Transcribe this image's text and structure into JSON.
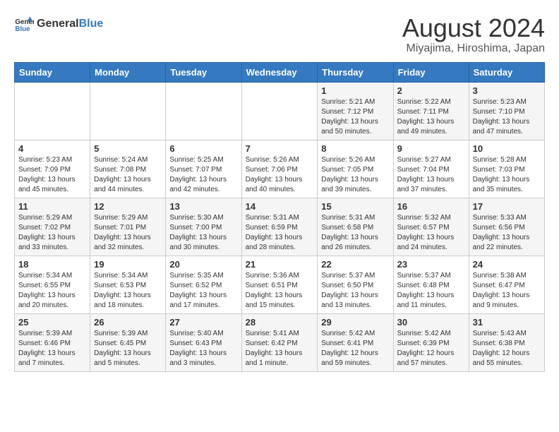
{
  "header": {
    "logo_general": "General",
    "logo_blue": "Blue",
    "title": "August 2024",
    "subtitle": "Miyajima, Hiroshima, Japan"
  },
  "calendar": {
    "days_of_week": [
      "Sunday",
      "Monday",
      "Tuesday",
      "Wednesday",
      "Thursday",
      "Friday",
      "Saturday"
    ],
    "weeks": [
      [
        {
          "day": "",
          "info": ""
        },
        {
          "day": "",
          "info": ""
        },
        {
          "day": "",
          "info": ""
        },
        {
          "day": "",
          "info": ""
        },
        {
          "day": "1",
          "info": "Sunrise: 5:21 AM\nSunset: 7:12 PM\nDaylight: 13 hours\nand 50 minutes."
        },
        {
          "day": "2",
          "info": "Sunrise: 5:22 AM\nSunset: 7:11 PM\nDaylight: 13 hours\nand 49 minutes."
        },
        {
          "day": "3",
          "info": "Sunrise: 5:23 AM\nSunset: 7:10 PM\nDaylight: 13 hours\nand 47 minutes."
        }
      ],
      [
        {
          "day": "4",
          "info": "Sunrise: 5:23 AM\nSunset: 7:09 PM\nDaylight: 13 hours\nand 45 minutes."
        },
        {
          "day": "5",
          "info": "Sunrise: 5:24 AM\nSunset: 7:08 PM\nDaylight: 13 hours\nand 44 minutes."
        },
        {
          "day": "6",
          "info": "Sunrise: 5:25 AM\nSunset: 7:07 PM\nDaylight: 13 hours\nand 42 minutes."
        },
        {
          "day": "7",
          "info": "Sunrise: 5:26 AM\nSunset: 7:06 PM\nDaylight: 13 hours\nand 40 minutes."
        },
        {
          "day": "8",
          "info": "Sunrise: 5:26 AM\nSunset: 7:05 PM\nDaylight: 13 hours\nand 39 minutes."
        },
        {
          "day": "9",
          "info": "Sunrise: 5:27 AM\nSunset: 7:04 PM\nDaylight: 13 hours\nand 37 minutes."
        },
        {
          "day": "10",
          "info": "Sunrise: 5:28 AM\nSunset: 7:03 PM\nDaylight: 13 hours\nand 35 minutes."
        }
      ],
      [
        {
          "day": "11",
          "info": "Sunrise: 5:29 AM\nSunset: 7:02 PM\nDaylight: 13 hours\nand 33 minutes."
        },
        {
          "day": "12",
          "info": "Sunrise: 5:29 AM\nSunset: 7:01 PM\nDaylight: 13 hours\nand 32 minutes."
        },
        {
          "day": "13",
          "info": "Sunrise: 5:30 AM\nSunset: 7:00 PM\nDaylight: 13 hours\nand 30 minutes."
        },
        {
          "day": "14",
          "info": "Sunrise: 5:31 AM\nSunset: 6:59 PM\nDaylight: 13 hours\nand 28 minutes."
        },
        {
          "day": "15",
          "info": "Sunrise: 5:31 AM\nSunset: 6:58 PM\nDaylight: 13 hours\nand 26 minutes."
        },
        {
          "day": "16",
          "info": "Sunrise: 5:32 AM\nSunset: 6:57 PM\nDaylight: 13 hours\nand 24 minutes."
        },
        {
          "day": "17",
          "info": "Sunrise: 5:33 AM\nSunset: 6:56 PM\nDaylight: 13 hours\nand 22 minutes."
        }
      ],
      [
        {
          "day": "18",
          "info": "Sunrise: 5:34 AM\nSunset: 6:55 PM\nDaylight: 13 hours\nand 20 minutes."
        },
        {
          "day": "19",
          "info": "Sunrise: 5:34 AM\nSunset: 6:53 PM\nDaylight: 13 hours\nand 18 minutes."
        },
        {
          "day": "20",
          "info": "Sunrise: 5:35 AM\nSunset: 6:52 PM\nDaylight: 13 hours\nand 17 minutes."
        },
        {
          "day": "21",
          "info": "Sunrise: 5:36 AM\nSunset: 6:51 PM\nDaylight: 13 hours\nand 15 minutes."
        },
        {
          "day": "22",
          "info": "Sunrise: 5:37 AM\nSunset: 6:50 PM\nDaylight: 13 hours\nand 13 minutes."
        },
        {
          "day": "23",
          "info": "Sunrise: 5:37 AM\nSunset: 6:48 PM\nDaylight: 13 hours\nand 11 minutes."
        },
        {
          "day": "24",
          "info": "Sunrise: 5:38 AM\nSunset: 6:47 PM\nDaylight: 13 hours\nand 9 minutes."
        }
      ],
      [
        {
          "day": "25",
          "info": "Sunrise: 5:39 AM\nSunset: 6:46 PM\nDaylight: 13 hours\nand 7 minutes."
        },
        {
          "day": "26",
          "info": "Sunrise: 5:39 AM\nSunset: 6:45 PM\nDaylight: 13 hours\nand 5 minutes."
        },
        {
          "day": "27",
          "info": "Sunrise: 5:40 AM\nSunset: 6:43 PM\nDaylight: 13 hours\nand 3 minutes."
        },
        {
          "day": "28",
          "info": "Sunrise: 5:41 AM\nSunset: 6:42 PM\nDaylight: 13 hours\nand 1 minute."
        },
        {
          "day": "29",
          "info": "Sunrise: 5:42 AM\nSunset: 6:41 PM\nDaylight: 12 hours\nand 59 minutes."
        },
        {
          "day": "30",
          "info": "Sunrise: 5:42 AM\nSunset: 6:39 PM\nDaylight: 12 hours\nand 57 minutes."
        },
        {
          "day": "31",
          "info": "Sunrise: 5:43 AM\nSunset: 6:38 PM\nDaylight: 12 hours\nand 55 minutes."
        }
      ]
    ]
  }
}
